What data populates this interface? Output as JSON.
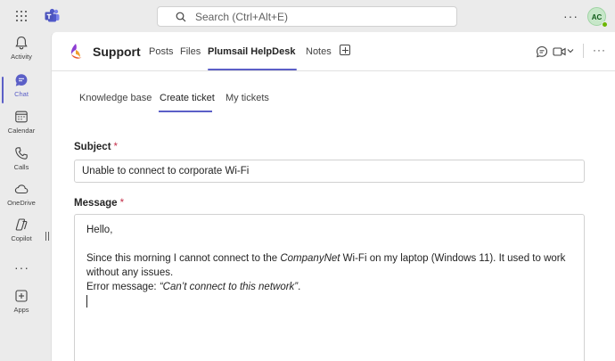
{
  "topbar": {
    "search_placeholder": "Search (Ctrl+Alt+E)",
    "more_label": "···",
    "avatar_initials": "AC"
  },
  "rail": {
    "items": [
      {
        "label": "Activity",
        "icon": "bell-icon"
      },
      {
        "label": "Chat",
        "icon": "chat-icon",
        "active": true
      },
      {
        "label": "Calendar",
        "icon": "calendar-icon"
      },
      {
        "label": "Calls",
        "icon": "phone-icon"
      },
      {
        "label": "OneDrive",
        "icon": "cloud-icon"
      },
      {
        "label": "Copilot",
        "icon": "copilot-icon"
      },
      {
        "label": "Apps",
        "icon": "add-apps-icon"
      }
    ],
    "more_label": "···",
    "collapse_label": "||"
  },
  "header": {
    "app_title": "Support",
    "tabs": [
      {
        "label": "Posts"
      },
      {
        "label": "Files"
      },
      {
        "label": "Plumsail HelpDesk",
        "active": true
      },
      {
        "label": "Notes"
      }
    ]
  },
  "content_tabs": [
    {
      "label": "Knowledge base"
    },
    {
      "label": "Create ticket",
      "active": true
    },
    {
      "label": "My tickets"
    }
  ],
  "form": {
    "subject_label": "Subject",
    "required_mark": "*",
    "subject_value": "Unable to connect to corporate Wi-Fi",
    "message_label": "Message",
    "message": {
      "greeting": "Hello,",
      "line1_pre": "Since this morning I cannot connect to the ",
      "line1_em": "CompanyNet",
      "line1_post": " Wi-Fi on my laptop (Windows 11). It used to work",
      "line2": "without any issues.",
      "line3_pre": "Error message: ",
      "line3_em": "“Can’t connect to this network”",
      "line3_post": "."
    }
  },
  "colors": {
    "accent": "#5b5fc7",
    "required": "#c4314b"
  }
}
